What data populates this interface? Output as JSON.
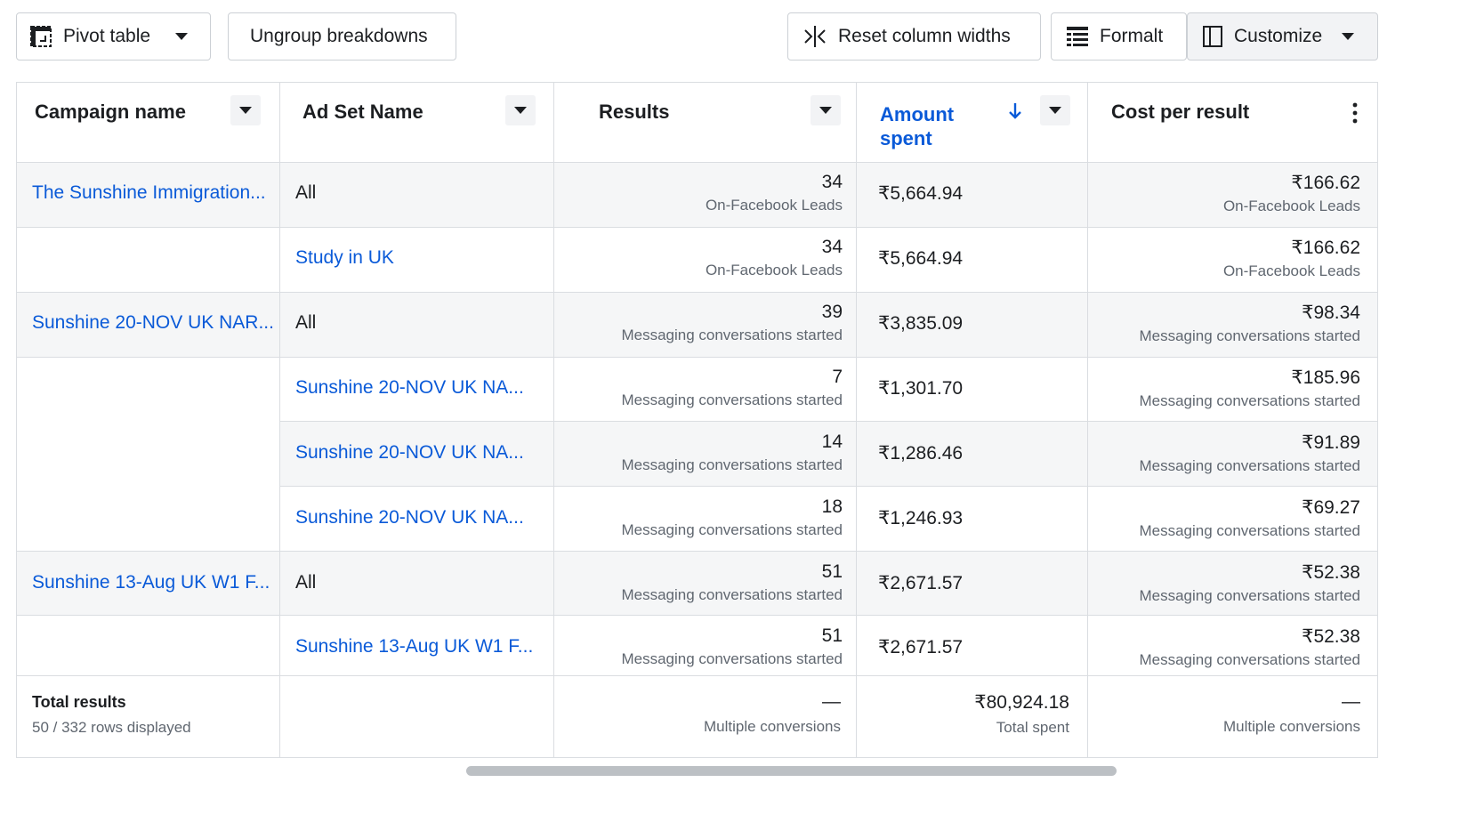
{
  "toolbar": {
    "pivot_label": "Pivot table",
    "ungroup_label": "Ungroup breakdowns",
    "reset_label": "Reset column widths",
    "format_label": "Formalt",
    "customize_label": "Customize"
  },
  "columns": {
    "campaign": "Campaign name",
    "adset": "Ad Set Name",
    "results": "Results",
    "amount": "Amount spent",
    "cpr": "Cost per result"
  },
  "rows": [
    {
      "campaign": "The Sunshine Immigration...",
      "adset": "All",
      "results": "34",
      "results_sub": "On-Facebook Leads",
      "amount": "₹5,664.94",
      "cpr": "₹166.62",
      "cpr_sub": "On-Facebook Leads"
    },
    {
      "campaign": "",
      "adset": "Study in UK",
      "results": "34",
      "results_sub": "On-Facebook Leads",
      "amount": "₹5,664.94",
      "cpr": "₹166.62",
      "cpr_sub": "On-Facebook Leads"
    },
    {
      "campaign": "Sunshine 20-NOV UK NAR...",
      "adset": "All",
      "results": "39",
      "results_sub": "Messaging conversations started",
      "amount": "₹3,835.09",
      "cpr": "₹98.34",
      "cpr_sub": "Messaging conversations started"
    },
    {
      "campaign": "",
      "adset": "Sunshine 20-NOV UK NA...",
      "results": "7",
      "results_sub": "Messaging conversations started",
      "amount": "₹1,301.70",
      "cpr": "₹185.96",
      "cpr_sub": "Messaging conversations started"
    },
    {
      "campaign": "",
      "adset": "Sunshine 20-NOV UK NA...",
      "results": "14",
      "results_sub": "Messaging conversations started",
      "amount": "₹1,286.46",
      "cpr": "₹91.89",
      "cpr_sub": "Messaging conversations started"
    },
    {
      "campaign": "",
      "adset": "Sunshine 20-NOV UK NA...",
      "results": "18",
      "results_sub": "Messaging conversations started",
      "amount": "₹1,246.93",
      "cpr": "₹69.27",
      "cpr_sub": "Messaging conversations started"
    },
    {
      "campaign": "Sunshine 13-Aug UK W1 F...",
      "adset": "All",
      "results": "51",
      "results_sub": "Messaging conversations started",
      "amount": "₹2,671.57",
      "cpr": "₹52.38",
      "cpr_sub": "Messaging conversations started"
    },
    {
      "campaign": "",
      "adset": "Sunshine 13-Aug UK W1 F...",
      "results": "51",
      "results_sub": "Messaging conversations started",
      "amount": "₹2,671.57",
      "cpr": "₹52.38",
      "cpr_sub": "Messaging conversations started"
    }
  ],
  "totals": {
    "title": "Total results",
    "rows_displayed": "50 / 332 rows displayed",
    "results": "—",
    "results_sub": "Multiple conversions",
    "amount": "₹80,924.18",
    "amount_sub": "Total spent",
    "cpr": "—",
    "cpr_sub": "Multiple conversions"
  },
  "colors": {
    "link": "#0a5ad8",
    "border": "#dadde1",
    "row_alt": "#f5f6f7"
  }
}
